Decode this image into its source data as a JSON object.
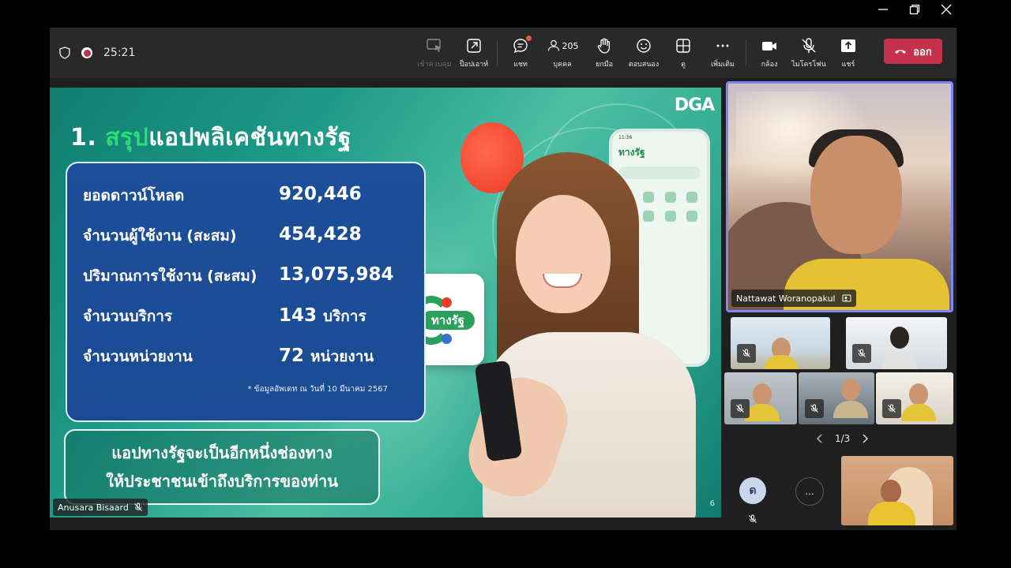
{
  "meeting": {
    "timer": "25:21"
  },
  "toolbar": {
    "items": [
      {
        "label": "เข้าควบคุม",
        "icon": "take-control-icon",
        "disabled": true
      },
      {
        "label": "ป็อปเอาท์",
        "icon": "popout-icon"
      },
      {
        "label": "แชท",
        "icon": "chat-icon"
      },
      {
        "label": "บุคคล",
        "icon": "people-icon",
        "count": "205"
      },
      {
        "label": "ยกมือ",
        "icon": "raise-hand-icon"
      },
      {
        "label": "ตอบสนอง",
        "icon": "react-icon"
      },
      {
        "label": "ดู",
        "icon": "view-icon"
      },
      {
        "label": "เพิ่มเติม",
        "icon": "more-icon"
      },
      {
        "label": "กล้อง",
        "icon": "camera-icon"
      },
      {
        "label": "ไมโครโฟน",
        "icon": "mic-off-icon"
      },
      {
        "label": "แชร์",
        "icon": "share-icon"
      }
    ],
    "leave_label": "ออก",
    "leave_color": "#c4314b"
  },
  "slide": {
    "title_num": "1.",
    "title_highlight": "สรุป",
    "title_rest": "แอปพลิเคชันทางรัฐ",
    "logo": "DGA",
    "stats": [
      {
        "label": "ยอดดาวน์โหลด",
        "value": "920,446",
        "unit": ""
      },
      {
        "label": "จำนวนผู้ใช้งาน (สะสม)",
        "value": "454,428",
        "unit": ""
      },
      {
        "label": "ปริมาณการใช้งาน (สะสม)",
        "value": "13,075,984",
        "unit": ""
      },
      {
        "label": "จำนวนบริการ",
        "value": "143",
        "unit": "บริการ"
      },
      {
        "label": "จำนวนหน่วยงาน",
        "value": "72",
        "unit": "หน่วยงาน"
      }
    ],
    "note": "* ข้อมูลอัพเดท ณ วันที่ 10 มีนาคม 2567",
    "tagline_1": "แอปทางรัฐจะเป็นอีกหนึ่งช่องทาง",
    "tagline_2": "ให้ประชาชนเข้าถึงบริการของท่าน",
    "app_icon_text": "ทางรัฐ",
    "phone_time": "11:36",
    "phone_app_name": "ทางรัฐ",
    "page_number": "6",
    "highlight_color": "#2ddc77",
    "box_color": "#1d4f98"
  },
  "presenter": {
    "name": "Anusara Bisaard"
  },
  "participants": {
    "main_name": "Nattawat Woranopakul",
    "pager": "1/3",
    "avatar_initial": "ด",
    "more_label": "...",
    "active_border_color": "#7f85f5"
  }
}
